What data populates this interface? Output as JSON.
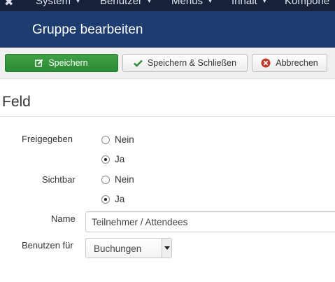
{
  "topnav": {
    "logo_icon": "joomla-icon",
    "menus": [
      {
        "label": "System"
      },
      {
        "label": "Benutzer"
      },
      {
        "label": "Menüs"
      },
      {
        "label": "Inhalt"
      },
      {
        "label": "Kompone"
      }
    ]
  },
  "header": {
    "title": "Gruppe bearbeiten"
  },
  "toolbar": {
    "save_label": "Speichern",
    "save_close_label": "Speichern & Schließen",
    "cancel_label": "Abbrechen"
  },
  "section": {
    "title": "Feld"
  },
  "fields": {
    "published": {
      "label": "Freigegeben",
      "options": [
        "Nein",
        "Ja"
      ],
      "selected": "Ja"
    },
    "visible": {
      "label": "Sichtbar",
      "options": [
        "Nein",
        "Ja"
      ],
      "selected": "Ja"
    },
    "name": {
      "label": "Name",
      "value": "Teilnehmer / Attendees"
    },
    "use_for": {
      "label": "Benutzen für",
      "selected": "Buchungen"
    }
  },
  "colors": {
    "topnav_bg": "#17223a",
    "header_bg": "#1d3c6f",
    "save_green": "#2f8f38",
    "cancel_red": "#c0392b"
  }
}
